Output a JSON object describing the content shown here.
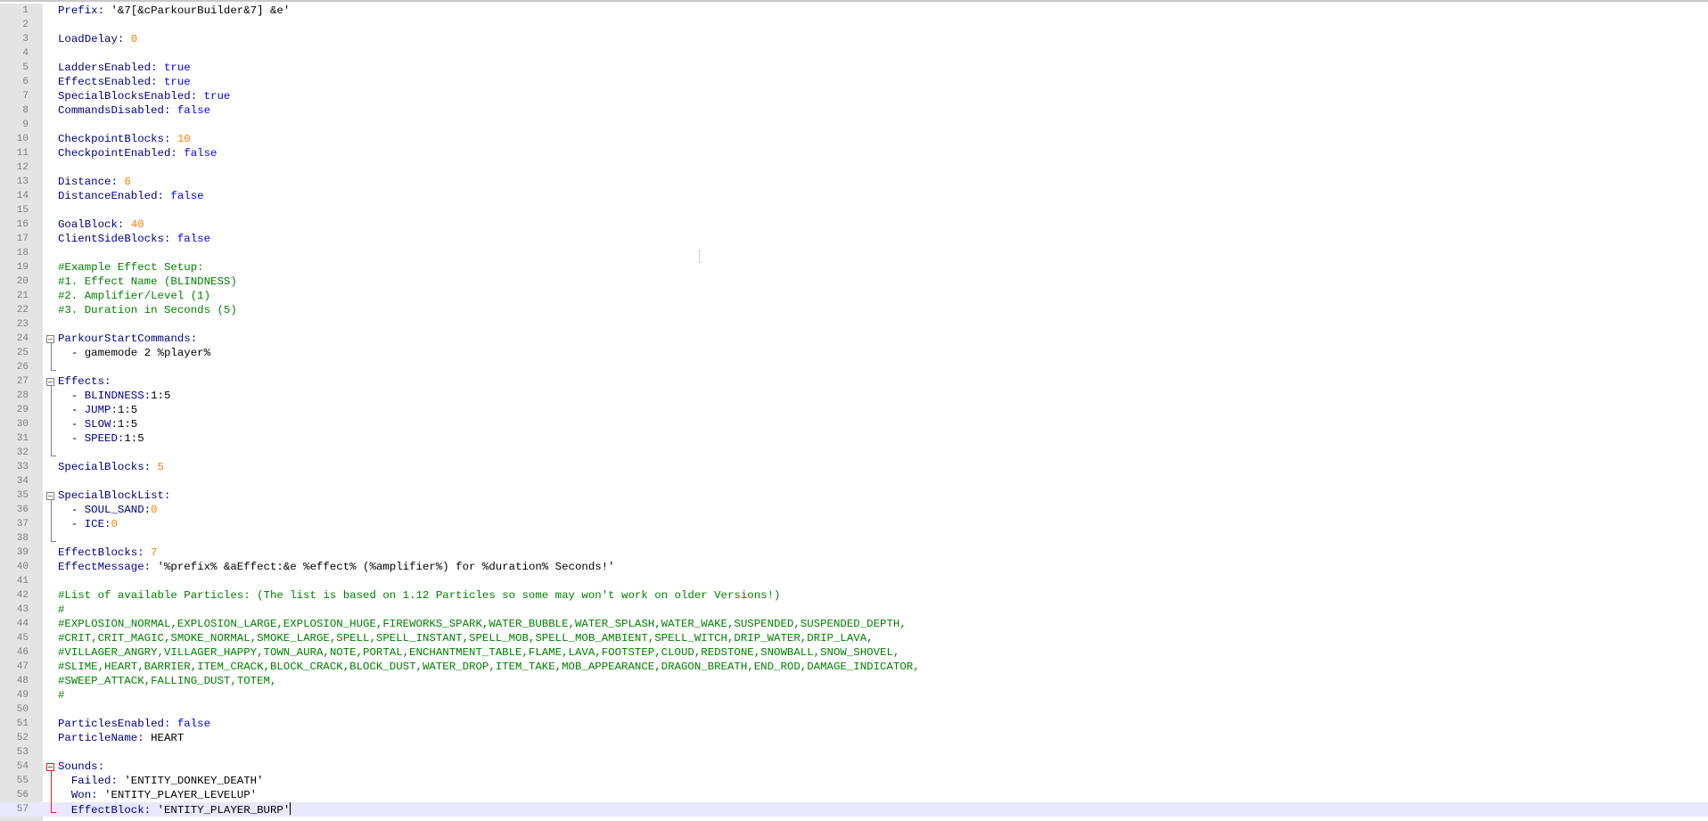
{
  "editor": {
    "lines": [
      {
        "n": "1",
        "t": [
          {
            "c": "k",
            "v": "Prefix: "
          },
          {
            "c": "s",
            "v": "'&7[&cParkourBuilder&7] &e'"
          }
        ]
      },
      {
        "n": "2",
        "t": []
      },
      {
        "n": "3",
        "t": [
          {
            "c": "k",
            "v": "LoadDelay: "
          },
          {
            "c": "n",
            "v": "0"
          }
        ]
      },
      {
        "n": "4",
        "t": []
      },
      {
        "n": "5",
        "t": [
          {
            "c": "k",
            "v": "LaddersEnabled: "
          },
          {
            "c": "kw",
            "v": "true"
          }
        ]
      },
      {
        "n": "6",
        "t": [
          {
            "c": "k",
            "v": "EffectsEnabled: "
          },
          {
            "c": "kw",
            "v": "true"
          }
        ]
      },
      {
        "n": "7",
        "t": [
          {
            "c": "k",
            "v": "SpecialBlocksEnabled: "
          },
          {
            "c": "kw",
            "v": "true"
          }
        ]
      },
      {
        "n": "8",
        "t": [
          {
            "c": "k",
            "v": "CommandsDisabled: "
          },
          {
            "c": "kw",
            "v": "false"
          }
        ]
      },
      {
        "n": "9",
        "t": []
      },
      {
        "n": "10",
        "t": [
          {
            "c": "k",
            "v": "CheckpointBlocks: "
          },
          {
            "c": "n",
            "v": "10"
          }
        ]
      },
      {
        "n": "11",
        "t": [
          {
            "c": "k",
            "v": "CheckpointEnabled: "
          },
          {
            "c": "kw",
            "v": "false"
          }
        ]
      },
      {
        "n": "12",
        "t": []
      },
      {
        "n": "13",
        "t": [
          {
            "c": "k",
            "v": "Distance: "
          },
          {
            "c": "n",
            "v": "6"
          }
        ]
      },
      {
        "n": "14",
        "t": [
          {
            "c": "k",
            "v": "DistanceEnabled: "
          },
          {
            "c": "kw",
            "v": "false"
          }
        ]
      },
      {
        "n": "15",
        "t": []
      },
      {
        "n": "16",
        "t": [
          {
            "c": "k",
            "v": "GoalBlock: "
          },
          {
            "c": "n",
            "v": "40"
          }
        ]
      },
      {
        "n": "17",
        "t": [
          {
            "c": "k",
            "v": "ClientSideBlocks: "
          },
          {
            "c": "kw",
            "v": "false"
          }
        ]
      },
      {
        "n": "18",
        "t": []
      },
      {
        "n": "19",
        "t": [
          {
            "c": "c",
            "v": "#Example Effect Setup:"
          }
        ]
      },
      {
        "n": "20",
        "t": [
          {
            "c": "c",
            "v": "#1. Effect Name (BLINDNESS)"
          }
        ]
      },
      {
        "n": "21",
        "t": [
          {
            "c": "c",
            "v": "#2. Amplifier/Level (1)"
          }
        ]
      },
      {
        "n": "22",
        "t": [
          {
            "c": "c",
            "v": "#3. Duration in Seconds (5)"
          }
        ]
      },
      {
        "n": "23",
        "t": []
      },
      {
        "n": "24",
        "f": "open",
        "t": [
          {
            "c": "k",
            "v": "ParkourStartCommands:"
          }
        ]
      },
      {
        "n": "25",
        "f": "line",
        "t": [
          {
            "c": "p",
            "v": "  - gamemode 2 %player%"
          }
        ]
      },
      {
        "n": "26",
        "f": "end",
        "t": []
      },
      {
        "n": "27",
        "f": "open",
        "t": [
          {
            "c": "k",
            "v": "Effects:"
          }
        ]
      },
      {
        "n": "28",
        "f": "line",
        "t": [
          {
            "c": "p",
            "v": "  - "
          },
          {
            "c": "k",
            "v": "BLINDNESS:"
          },
          {
            "c": "p",
            "v": "1:5"
          }
        ]
      },
      {
        "n": "29",
        "f": "line",
        "t": [
          {
            "c": "p",
            "v": "  - "
          },
          {
            "c": "k",
            "v": "JUMP:"
          },
          {
            "c": "p",
            "v": "1:5"
          }
        ]
      },
      {
        "n": "30",
        "f": "line",
        "t": [
          {
            "c": "p",
            "v": "  - "
          },
          {
            "c": "k",
            "v": "SLOW:"
          },
          {
            "c": "p",
            "v": "1:5"
          }
        ]
      },
      {
        "n": "31",
        "f": "line",
        "t": [
          {
            "c": "p",
            "v": "  - "
          },
          {
            "c": "k",
            "v": "SPEED:"
          },
          {
            "c": "p",
            "v": "1:5"
          }
        ]
      },
      {
        "n": "32",
        "f": "end",
        "t": []
      },
      {
        "n": "33",
        "t": [
          {
            "c": "k",
            "v": "SpecialBlocks: "
          },
          {
            "c": "n",
            "v": "5"
          }
        ]
      },
      {
        "n": "34",
        "t": []
      },
      {
        "n": "35",
        "f": "open",
        "t": [
          {
            "c": "k",
            "v": "SpecialBlockList:"
          }
        ]
      },
      {
        "n": "36",
        "f": "line",
        "t": [
          {
            "c": "p",
            "v": "  - "
          },
          {
            "c": "k",
            "v": "SOUL_SAND:"
          },
          {
            "c": "n",
            "v": "0"
          }
        ]
      },
      {
        "n": "37",
        "f": "line",
        "t": [
          {
            "c": "p",
            "v": "  - "
          },
          {
            "c": "k",
            "v": "ICE:"
          },
          {
            "c": "n",
            "v": "0"
          }
        ]
      },
      {
        "n": "38",
        "f": "end",
        "t": []
      },
      {
        "n": "39",
        "t": [
          {
            "c": "k",
            "v": "EffectBlocks: "
          },
          {
            "c": "n",
            "v": "7"
          }
        ]
      },
      {
        "n": "40",
        "t": [
          {
            "c": "k",
            "v": "EffectMessage: "
          },
          {
            "c": "s",
            "v": "'%prefix% &aEffect:&e %effect% (%amplifier%) for %duration% Seconds!'"
          }
        ]
      },
      {
        "n": "41",
        "t": []
      },
      {
        "n": "42",
        "t": [
          {
            "c": "c",
            "v": "#List of available Particles: (The list is based on 1.12 Particles so some may won't work on older Versions!)"
          }
        ]
      },
      {
        "n": "43",
        "t": [
          {
            "c": "c",
            "v": "#"
          }
        ]
      },
      {
        "n": "44",
        "t": [
          {
            "c": "c",
            "v": "#EXPLOSION_NORMAL,EXPLOSION_LARGE,EXPLOSION_HUGE,FIREWORKS_SPARK,WATER_BUBBLE,WATER_SPLASH,WATER_WAKE,SUSPENDED,SUSPENDED_DEPTH,"
          }
        ]
      },
      {
        "n": "45",
        "t": [
          {
            "c": "c",
            "v": "#CRIT,CRIT_MAGIC,SMOKE_NORMAL,SMOKE_LARGE,SPELL,SPELL_INSTANT,SPELL_MOB,SPELL_MOB_AMBIENT,SPELL_WITCH,DRIP_WATER,DRIP_LAVA,"
          }
        ]
      },
      {
        "n": "46",
        "t": [
          {
            "c": "c",
            "v": "#VILLAGER_ANGRY,VILLAGER_HAPPY,TOWN_AURA,NOTE,PORTAL,ENCHANTMENT_TABLE,FLAME,LAVA,FOOTSTEP,CLOUD,REDSTONE,SNOWBALL,SNOW_SHOVEL,"
          }
        ]
      },
      {
        "n": "47",
        "t": [
          {
            "c": "c",
            "v": "#SLIME,HEART,BARRIER,ITEM_CRACK,BLOCK_CRACK,BLOCK_DUST,WATER_DROP,ITEM_TAKE,MOB_APPEARANCE,DRAGON_BREATH,END_ROD,DAMAGE_INDICATOR,"
          }
        ]
      },
      {
        "n": "48",
        "t": [
          {
            "c": "c",
            "v": "#SWEEP_ATTACK,FALLING_DUST,TOTEM,"
          }
        ]
      },
      {
        "n": "49",
        "t": [
          {
            "c": "c",
            "v": "#"
          }
        ]
      },
      {
        "n": "50",
        "t": []
      },
      {
        "n": "51",
        "t": [
          {
            "c": "k",
            "v": "ParticlesEnabled: "
          },
          {
            "c": "kw",
            "v": "false"
          }
        ]
      },
      {
        "n": "52",
        "t": [
          {
            "c": "k",
            "v": "ParticleName: "
          },
          {
            "c": "p",
            "v": "HEART"
          }
        ]
      },
      {
        "n": "53",
        "t": []
      },
      {
        "n": "54",
        "f": "open-red",
        "t": [
          {
            "c": "k",
            "v": "Sounds:"
          }
        ]
      },
      {
        "n": "55",
        "f": "line-red",
        "t": [
          {
            "c": "p",
            "v": "  "
          },
          {
            "c": "k",
            "v": "Failed: "
          },
          {
            "c": "s",
            "v": "'ENTITY_DONKEY_DEATH'"
          }
        ]
      },
      {
        "n": "56",
        "f": "line-red",
        "t": [
          {
            "c": "p",
            "v": "  "
          },
          {
            "c": "k",
            "v": "Won: "
          },
          {
            "c": "s",
            "v": "'ENTITY_PLAYER_LEVELUP'"
          }
        ]
      },
      {
        "n": "57",
        "f": "end-red",
        "current": true,
        "caret": true,
        "t": [
          {
            "c": "p",
            "v": "  "
          },
          {
            "c": "k",
            "v": "EffectBlock: "
          },
          {
            "c": "s",
            "v": "'ENTITY_PLAYER_BURP'"
          }
        ]
      }
    ]
  }
}
